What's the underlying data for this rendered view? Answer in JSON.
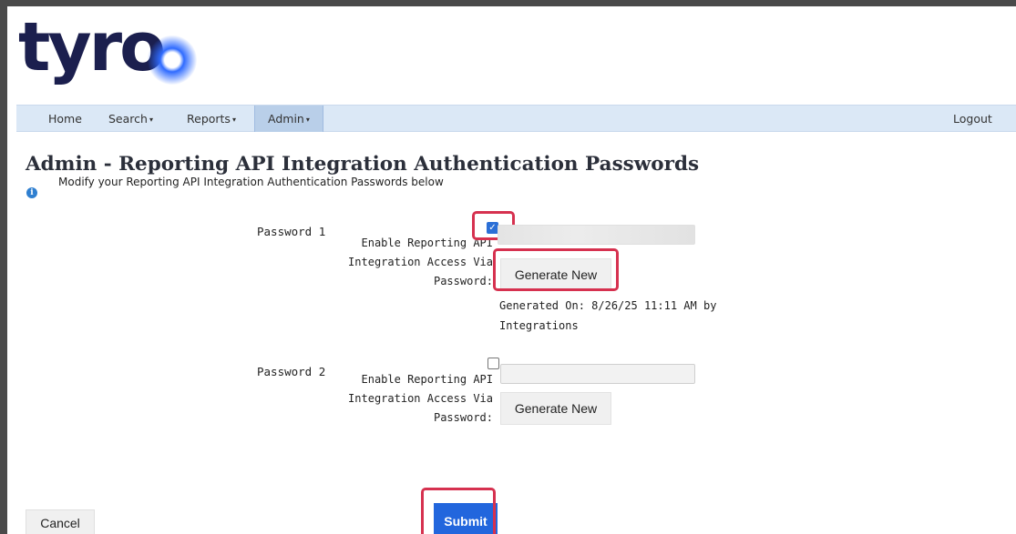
{
  "logo": {
    "text": "tyro"
  },
  "nav": {
    "home": "Home",
    "search": "Search",
    "reports": "Reports",
    "admin": "Admin",
    "logout": "Logout",
    "caret": "▾"
  },
  "page": {
    "title": "Admin - Reporting API Integration Authentication Passwords",
    "subtitle": "Modify your Reporting API Integration Authentication Passwords below",
    "info_icon_glyph": "i"
  },
  "password1": {
    "label": "Password 1",
    "enable_line1": "Enable Reporting API",
    "enable_line2": "Integration Access Via",
    "enable_line3": "Password:",
    "checked": true,
    "check_glyph": "✓",
    "value": "",
    "generate_label": "Generate New",
    "generated_line1": "Generated On: 8/26/25 11:11 AM by",
    "generated_line2": "Integrations"
  },
  "password2": {
    "label": "Password 2",
    "enable_line1": "Enable Reporting API",
    "enable_line2": "Integration Access Via",
    "enable_line3": "Password:",
    "checked": false,
    "value": "",
    "generate_label": "Generate New"
  },
  "actions": {
    "cancel": "Cancel",
    "submit": "Submit"
  },
  "colors": {
    "highlight": "#d6314f",
    "submit_bg": "#2266dd",
    "nav_bg": "#dbe8f6",
    "logo": "#1b1f4e"
  }
}
